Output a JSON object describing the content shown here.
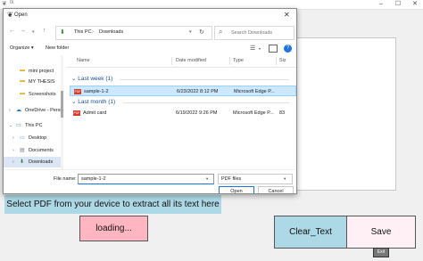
{
  "app": {
    "title": "tk",
    "textarea": "",
    "extract_label": "Select PDF from your device to extract all its text here",
    "loading_button": "loading...",
    "clear_button": "Clear_Text",
    "save_button": "Save",
    "exit_button": "Exit",
    "colors": {
      "label_bg": "#add8e6",
      "loading_bg": "#ffb6c1",
      "clear_bg": "#add8e6",
      "save_bg": "#fff0f5"
    }
  },
  "dialog": {
    "title": "Open",
    "address": {
      "parts": [
        "This PC",
        "Downloads"
      ],
      "separator": "›"
    },
    "search_placeholder": "Search Downloads",
    "toolbar": {
      "organize": "Organize ▾",
      "new_folder": "New folder"
    },
    "nav_items": [
      {
        "label": "mini project",
        "icon": "folder-icon"
      },
      {
        "label": "MY THESIS",
        "icon": "folder-icon"
      },
      {
        "label": "Screenshots",
        "icon": "folder-icon"
      },
      {
        "label": "OneDrive - Perso",
        "icon": "cloud-icon"
      },
      {
        "label": "This PC",
        "icon": "pc-icon"
      },
      {
        "label": "Desktop",
        "icon": "desktop-icon"
      },
      {
        "label": "Documents",
        "icon": "documents-icon"
      },
      {
        "label": "Downloads",
        "icon": "download-icon",
        "selected": true
      }
    ],
    "columns": {
      "name": "Name",
      "date": "Date modified",
      "type": "Type",
      "size": "Siz"
    },
    "groups": [
      {
        "header": "Last week (1)",
        "files": [
          {
            "name": "sample-1-2",
            "date": "6/23/2022 8:12 PM",
            "type": "Microsoft Edge P...",
            "size": "",
            "selected": true
          }
        ]
      },
      {
        "header": "Last month (1)",
        "files": [
          {
            "name": "Admit card",
            "date": "6/19/2022 9:26 PM",
            "type": "Microsoft Edge P...",
            "size": "83"
          }
        ]
      }
    ],
    "file_name_label": "File name:",
    "file_name_value": "sample-1-2",
    "file_type_value": "PDF files",
    "open_button": "Open",
    "cancel_button": "Cancel",
    "pdf_badge": "PDF"
  }
}
